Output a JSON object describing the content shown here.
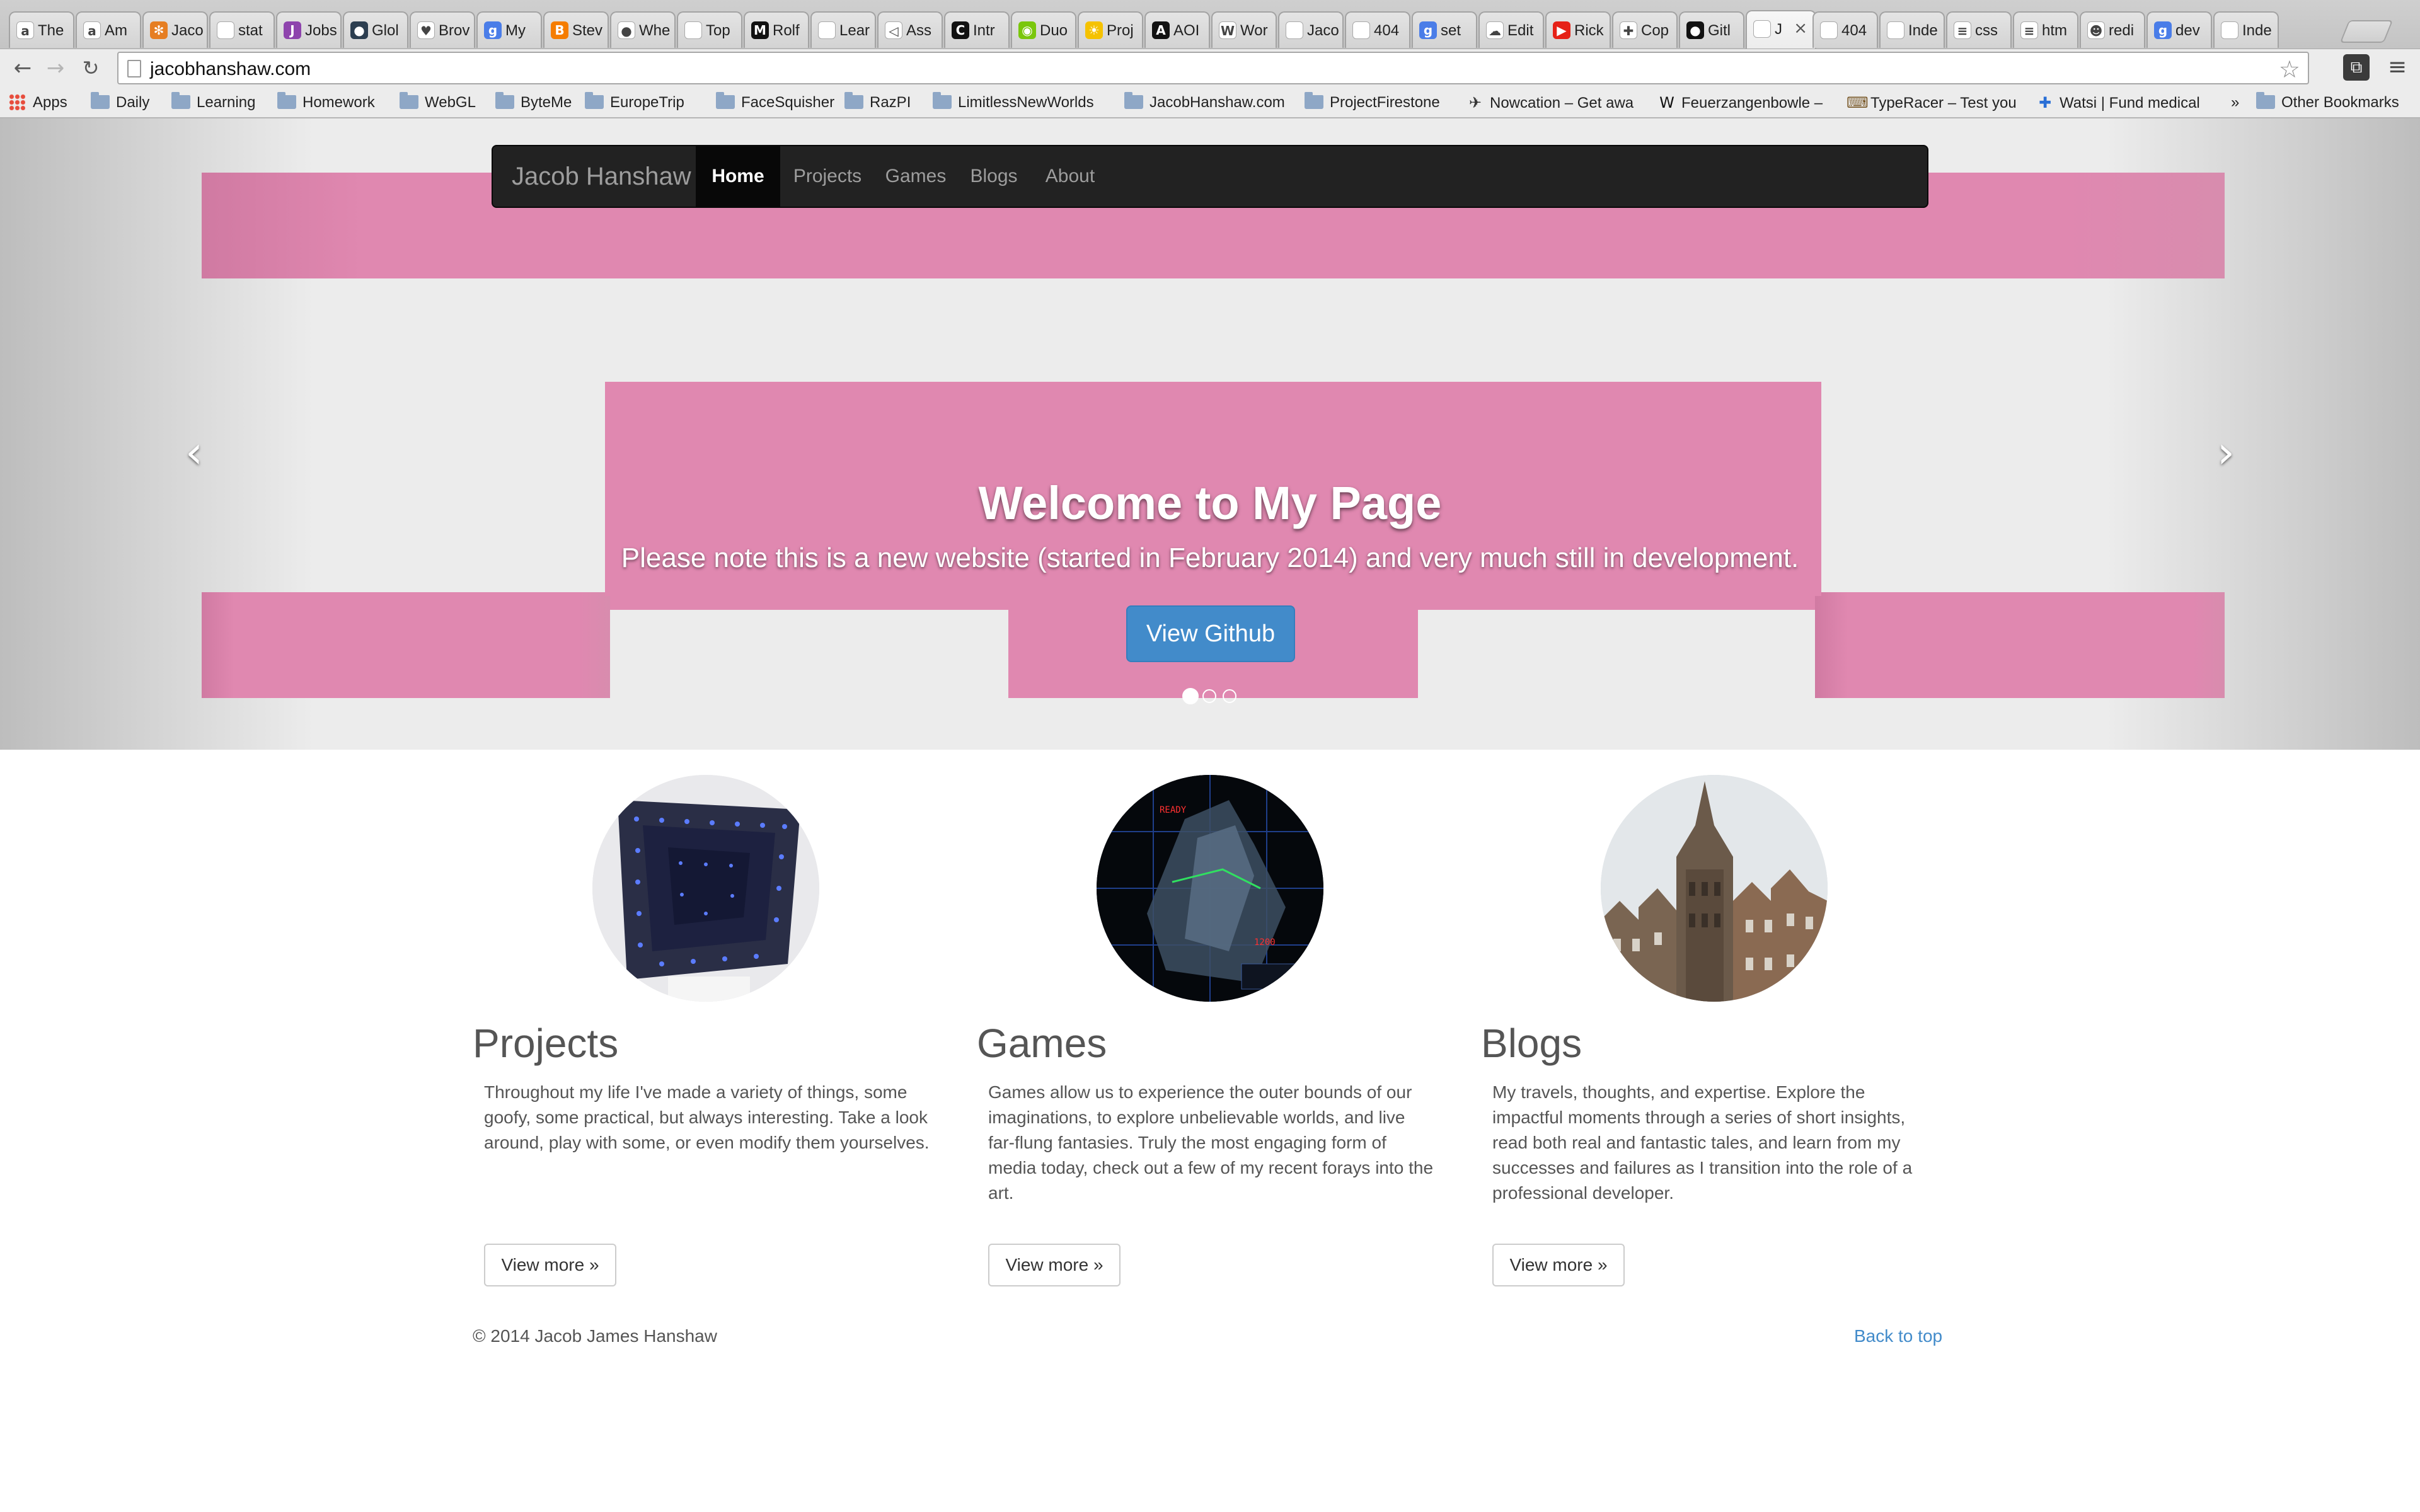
{
  "browser": {
    "tabs": [
      {
        "label": "The",
        "icon": "amazon-icon",
        "color": "#ffffff",
        "glyph": "a"
      },
      {
        "label": "Am",
        "icon": "amazon-icon",
        "color": "#ffffff",
        "glyph": "a"
      },
      {
        "label": "Jaco",
        "icon": "spiral-icon",
        "color": "#e67e22",
        "glyph": "✻"
      },
      {
        "label": "stat",
        "icon": "page-icon",
        "color": "#ffffff",
        "glyph": ""
      },
      {
        "label": "Jobs",
        "icon": "jobs-icon",
        "color": "#8e44ad",
        "glyph": "J"
      },
      {
        "label": "Glol",
        "icon": "globe-icon",
        "color": "#2c3e50",
        "glyph": "●"
      },
      {
        "label": "Brov",
        "icon": "heart-icon",
        "color": "#ffffff",
        "glyph": "♥"
      },
      {
        "label": "My",
        "icon": "google-icon",
        "color": "#4a7de8",
        "glyph": "g"
      },
      {
        "label": "Stev",
        "icon": "blogger-icon",
        "color": "#f57d00",
        "glyph": "B"
      },
      {
        "label": "Whe",
        "icon": "balloon-icon",
        "color": "#ffffff",
        "glyph": "●"
      },
      {
        "label": "Top",
        "icon": "page-icon",
        "color": "#ffffff",
        "glyph": ""
      },
      {
        "label": "Rolf",
        "icon": "m-icon",
        "color": "#111111",
        "glyph": "M"
      },
      {
        "label": "Lear",
        "icon": "page-icon",
        "color": "#ffffff",
        "glyph": ""
      },
      {
        "label": "Ass",
        "icon": "send-icon",
        "color": "#ffffff",
        "glyph": "◁"
      },
      {
        "label": "Intr",
        "icon": "c-icon",
        "color": "#111111",
        "glyph": "C"
      },
      {
        "label": "Duo",
        "icon": "duolingo-icon",
        "color": "#7ac70c",
        "glyph": "◉"
      },
      {
        "label": "Proj",
        "icon": "sun-icon",
        "color": "#f5c200",
        "glyph": "☀"
      },
      {
        "label": "AOI",
        "icon": "aol-icon",
        "color": "#111111",
        "glyph": "A"
      },
      {
        "label": "Wor",
        "icon": "wordpress-icon",
        "color": "#ffffff",
        "glyph": "W"
      },
      {
        "label": "Jaco",
        "icon": "page-icon",
        "color": "#ffffff",
        "glyph": ""
      },
      {
        "label": "404",
        "icon": "page-icon",
        "color": "#ffffff",
        "glyph": ""
      },
      {
        "label": "set",
        "icon": "google-icon",
        "color": "#4a7de8",
        "glyph": "g"
      },
      {
        "label": "Edit",
        "icon": "cloud-icon",
        "color": "#ffffff",
        "glyph": "☁"
      },
      {
        "label": "Rick",
        "icon": "youtube-icon",
        "color": "#e62117",
        "glyph": "▶"
      },
      {
        "label": "Cop",
        "icon": "maps-icon",
        "color": "#ffffff",
        "glyph": "✚"
      },
      {
        "label": "Gitl",
        "icon": "github-icon",
        "color": "#111111",
        "glyph": "●"
      },
      {
        "label": "J",
        "icon": "page-icon",
        "color": "#ffffff",
        "glyph": "",
        "active": true
      },
      {
        "label": "404",
        "icon": "page-icon",
        "color": "#ffffff",
        "glyph": ""
      },
      {
        "label": "Inde",
        "icon": "page-icon",
        "color": "#ffffff",
        "glyph": ""
      },
      {
        "label": "css",
        "icon": "stack-icon",
        "color": "#ffffff",
        "glyph": "≡"
      },
      {
        "label": "htm",
        "icon": "stack-icon",
        "color": "#ffffff",
        "glyph": "≡"
      },
      {
        "label": "redi",
        "icon": "reddit-icon",
        "color": "#ffffff",
        "glyph": "☻"
      },
      {
        "label": "dev",
        "icon": "google-icon",
        "color": "#4a7de8",
        "glyph": "g"
      },
      {
        "label": "Inde",
        "icon": "page-icon",
        "color": "#ffffff",
        "glyph": ""
      }
    ],
    "active_tab_close": "×",
    "url": "jacobhanshaw.com",
    "bookmarks": [
      {
        "label": "Apps",
        "type": "apps"
      },
      {
        "label": "Daily",
        "type": "folder"
      },
      {
        "label": "Learning",
        "type": "folder"
      },
      {
        "label": "Homework",
        "type": "folder"
      },
      {
        "label": "WebGL",
        "type": "folder"
      },
      {
        "label": "ByteMe",
        "type": "folder"
      },
      {
        "label": "EuropeTrip",
        "type": "folder"
      },
      {
        "label": "FaceSquisher",
        "type": "folder"
      },
      {
        "label": "RazPI",
        "type": "folder"
      },
      {
        "label": "LimitlessNewWorlds",
        "type": "folder"
      },
      {
        "label": "JacobHanshaw.com",
        "type": "folder"
      },
      {
        "label": "ProjectFirestone",
        "type": "folder"
      },
      {
        "label": "Nowcation – Get awa",
        "type": "plane"
      },
      {
        "label": "Feuerzangenbowle –",
        "type": "wikipedia"
      },
      {
        "label": "TypeRacer – Test you",
        "type": "typeracer"
      },
      {
        "label": "Watsi | Fund medical",
        "type": "watsi"
      },
      {
        "label": "»",
        "type": "overflow"
      },
      {
        "label": "Other Bookmarks",
        "type": "folder"
      }
    ]
  },
  "navbar": {
    "brand": "Jacob Hanshaw",
    "items": [
      {
        "label": "Home",
        "active": true
      },
      {
        "label": "Projects"
      },
      {
        "label": "Games"
      },
      {
        "label": "Blogs"
      },
      {
        "label": "About"
      }
    ]
  },
  "carousel": {
    "heading": "Welcome to My Page",
    "subtitle": "Please note this is a new website (started in February 2014) and very much still in development.",
    "button": "View Github",
    "prev": "‹",
    "next": "›",
    "slides": 3,
    "active_slide": 0,
    "colors": {
      "pink": "#e088b0",
      "background": "#ececec",
      "button": "#428bca"
    }
  },
  "columns": [
    {
      "title": "Projects",
      "text": "Throughout my life I've made a variety of things, some goofy, some practical, but always interesting. Take a look around, play with some, or even modify them yourselves.",
      "button": "View more »",
      "image": "infinity-mirror-photo"
    },
    {
      "title": "Games",
      "text": "Games allow us to experience the outer bounds of our imaginations, to explore unbelievable worlds, and live far-flung fantasies. Truly the most engaging form of media today, check out a few of my recent forays into the art.",
      "button": "View more »",
      "image": "space-game-screenshot"
    },
    {
      "title": "Blogs",
      "text": "My travels, thoughts, and expertise. Explore the impactful moments through a series of short insights, read both real and fantastic tales, and learn from my successes and failures as I transition into the role of a professional developer.",
      "button": "View more »",
      "image": "antwerp-city-hall-photo"
    }
  ],
  "footer": {
    "copyright": "© 2014 Jacob James Hanshaw",
    "back_to_top": "Back to top"
  }
}
